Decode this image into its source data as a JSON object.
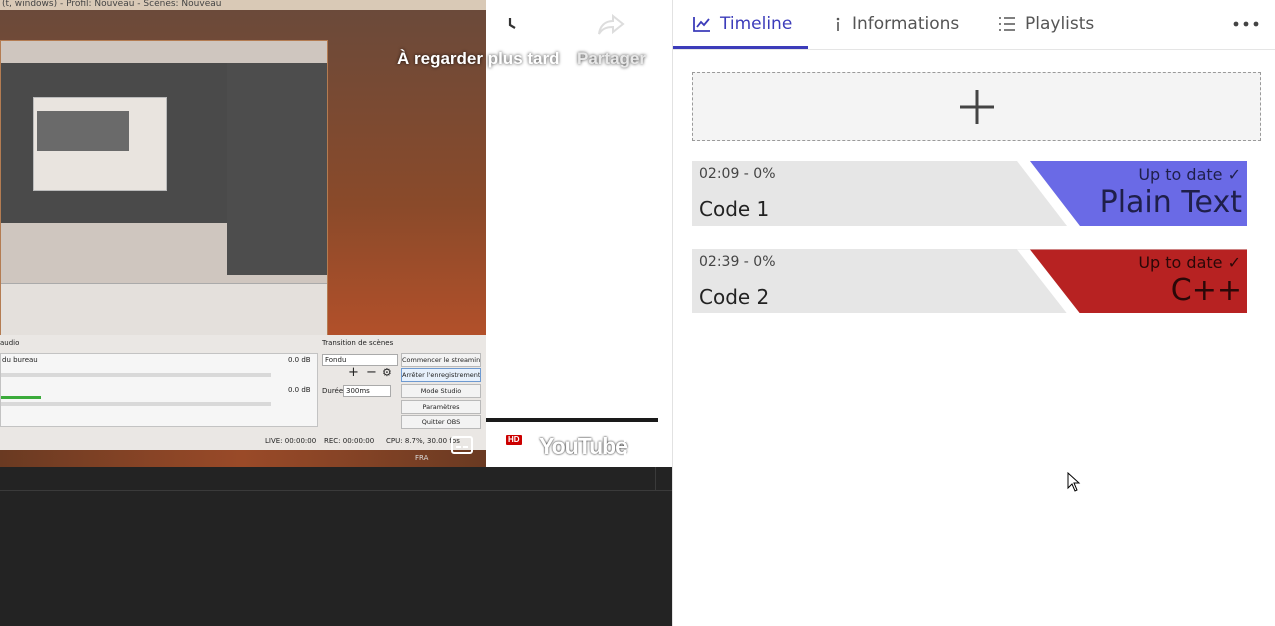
{
  "window_title": "(t, windows) - Profil: Nouveau - Scènes: Nouveau",
  "obs": {
    "mixer_label": "audio",
    "transition_label": "Transition de scènes",
    "desktop_audio": "du bureau",
    "db_1": "0.0 dB",
    "db_2": "0.0 dB",
    "transition_value": "Fondu",
    "duration_label": "Durée",
    "duration_value": "300ms",
    "buttons": [
      "Commencer le streaming",
      "Arrêter l'enregistrement",
      "Mode Studio",
      "Paramètres",
      "Quitter OBS"
    ],
    "status": {
      "live": "LIVE: 00:00:00",
      "rec": "REC: 00:00:00",
      "cpu": "CPU: 8.7%, 30.00 fps"
    },
    "taskbar_lang": "FRA"
  },
  "video_overlay": {
    "watch_later": "À regarder plus tard",
    "share": "Partager",
    "hd": "HD",
    "logo": "YouTube"
  },
  "tabs": [
    {
      "label": "Timeline",
      "icon": "chart-line-icon",
      "active": true
    },
    {
      "label": "Informations",
      "icon": "info-icon",
      "active": false
    },
    {
      "label": "Playlists",
      "icon": "list-icon",
      "active": false
    }
  ],
  "codes": [
    {
      "meta": "02:09 - 0%",
      "name": "Code 1",
      "status": "Up to date ✓",
      "language": "Plain Text",
      "color": "#6a6ae6",
      "text_color": "#1f1f4a"
    },
    {
      "meta": "02:39 - 0%",
      "name": "Code 2",
      "status": "Up to date ✓",
      "language": "C++",
      "color": "#b72222",
      "text_color": "#2a0808"
    }
  ],
  "colors": {
    "accent": "#3c3cba"
  }
}
